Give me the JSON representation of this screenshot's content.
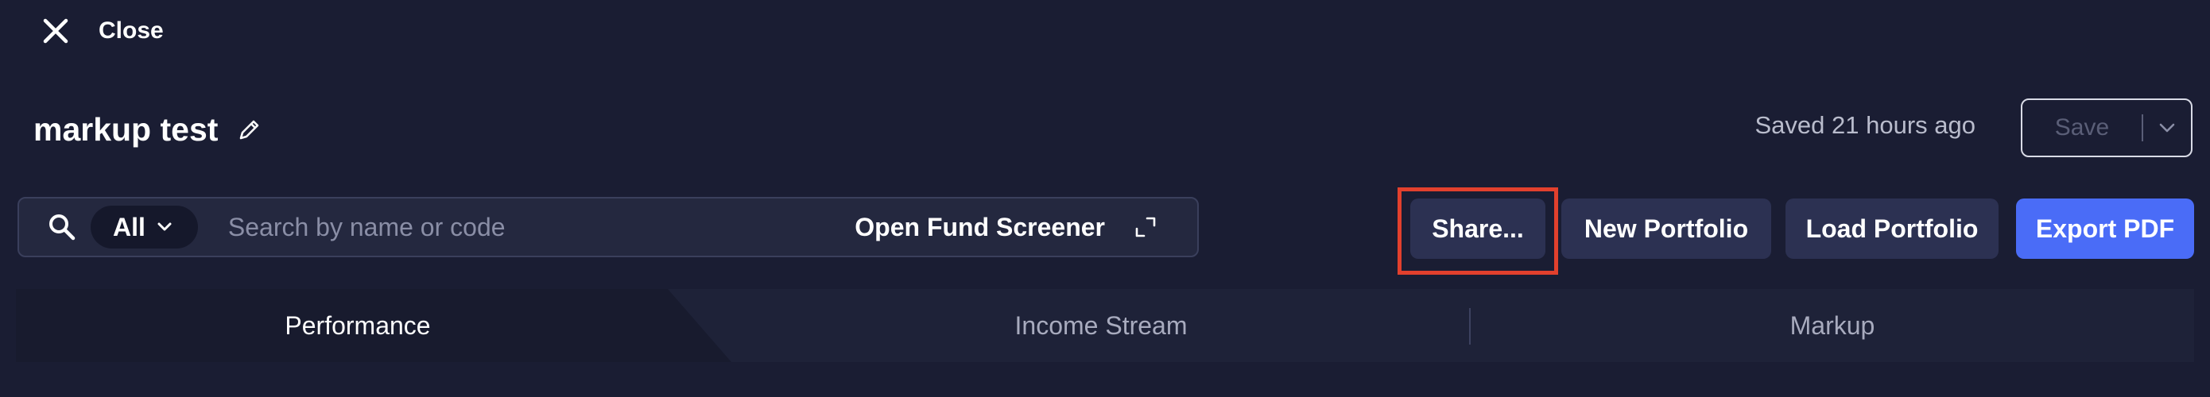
{
  "header": {
    "close_label": "Close",
    "title": "markup test",
    "saved_status": "Saved 21 hours ago",
    "save_label": "Save"
  },
  "search": {
    "filter_label": "All",
    "placeholder": "Search by name or code",
    "value": "",
    "open_screener_label": "Open Fund Screener"
  },
  "actions": {
    "share_label": "Share...",
    "new_portfolio_label": "New Portfolio",
    "load_portfolio_label": "Load Portfolio",
    "export_pdf_label": "Export PDF"
  },
  "tabs": [
    {
      "label": "Performance",
      "active": true
    },
    {
      "label": "Income Stream",
      "active": false
    },
    {
      "label": "Markup",
      "active": false
    }
  ],
  "colors": {
    "background": "#1a1d33",
    "button": "#2c3152",
    "primary": "#4a6cf7",
    "highlight": "#e2402d"
  },
  "icons": [
    "close-icon",
    "pencil-icon",
    "chevron-down-icon",
    "search-icon",
    "expand-icon"
  ]
}
